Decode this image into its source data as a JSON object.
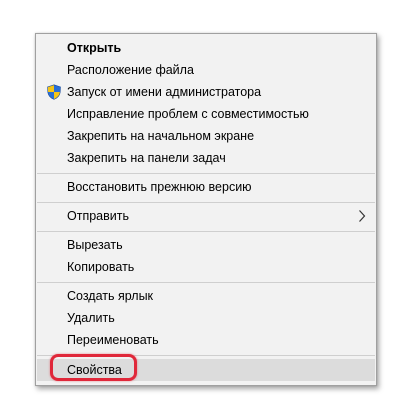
{
  "menu": {
    "open": "Открыть",
    "file_location": "Расположение файла",
    "run_as_admin": "Запуск от имени администратора",
    "troubleshoot_compat": "Исправление проблем с совместимостью",
    "pin_to_start": "Закрепить на начальном экране",
    "pin_to_taskbar": "Закрепить на панели задач",
    "restore_previous": "Восстановить прежнюю версию",
    "send_to": "Отправить",
    "cut": "Вырезать",
    "copy": "Копировать",
    "create_shortcut": "Создать ярлык",
    "delete": "Удалить",
    "rename": "Переименовать",
    "properties": "Свойства"
  },
  "icons": {
    "run_as_admin": "uac-shield-icon",
    "send_to": "chevron-right-icon"
  },
  "colors": {
    "highlight_ring": "#e0283a",
    "menu_background": "#f2f2f2",
    "hover_background": "#dcdcdc"
  }
}
